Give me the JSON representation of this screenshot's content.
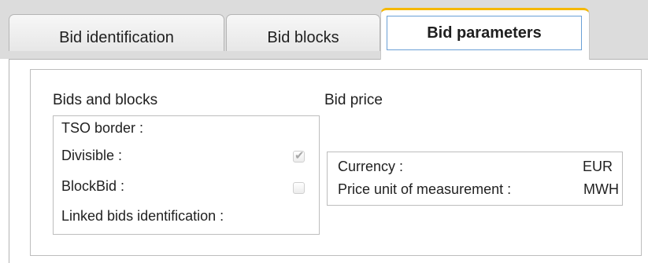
{
  "tabs": [
    {
      "label": "Bid identification",
      "active": false
    },
    {
      "label": "Bid blocks",
      "active": false
    },
    {
      "label": "Bid parameters",
      "active": true
    }
  ],
  "bids_and_blocks": {
    "heading": "Bids and blocks",
    "tso_border_label": "TSO border :",
    "divisible_label": "Divisible :",
    "divisible_checked": true,
    "blockbid_label": "BlockBid :",
    "blockbid_checked": false,
    "linked_bids_label": "Linked bids identification :"
  },
  "bid_price": {
    "heading": "Bid price",
    "currency_label": "Currency :",
    "currency_value": "EUR",
    "unit_label": "Price unit of measurement :",
    "unit_value": "MWH"
  },
  "colors": {
    "active_tab_accent": "#f5b800",
    "tab_strip_background": "#dcdcdc",
    "focus_border": "#6aa0d6"
  },
  "icons": {
    "check": "check-mark-icon"
  }
}
